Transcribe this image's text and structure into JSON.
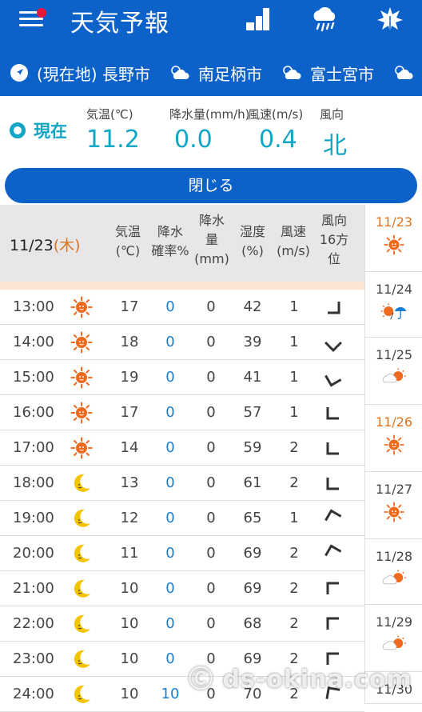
{
  "app": {
    "title": "天気予報"
  },
  "header_icons": [
    "ranking-icon",
    "rain-icon",
    "leaf-icon"
  ],
  "tabs": [
    {
      "label": "(現在地) 長野市",
      "icon": "location-arrow-icon"
    },
    {
      "label": "南足柄市",
      "icon": "cloud-sun-icon"
    },
    {
      "label": "富士宮市",
      "icon": "cloud-sun-icon"
    }
  ],
  "current": {
    "label": "現在",
    "metrics": [
      {
        "label": "気温(℃)",
        "value": "11.2"
      },
      {
        "label": "降水量(mm/h)",
        "value": "0.0"
      },
      {
        "label": "風速(m/s)",
        "value": "0.4"
      },
      {
        "label": "風向",
        "value": "北"
      }
    ]
  },
  "close_label": "閉じる",
  "table": {
    "date": "11/23",
    "weekday": "(木)",
    "headers": {
      "temp": [
        "気温",
        "(℃)"
      ],
      "prob": [
        "降水",
        "確率%"
      ],
      "rain": [
        "降水",
        "量",
        "(mm)"
      ],
      "humidity": [
        "湿度",
        "(%)"
      ],
      "windspeed": [
        "風速",
        "(m/s)"
      ],
      "winddir": [
        "風向",
        "16方",
        "位"
      ]
    },
    "rows": [
      {
        "time": "13:00",
        "weather": "sun",
        "temp": "17",
        "prob": "0",
        "rain": "0",
        "humidity": "42",
        "wind": "1",
        "dir_angle": 180
      },
      {
        "time": "14:00",
        "weather": "sun",
        "temp": "18",
        "prob": "0",
        "rain": "0",
        "humidity": "39",
        "wind": "1",
        "dir_angle": 225
      },
      {
        "time": "15:00",
        "weather": "sun",
        "temp": "19",
        "prob": "0",
        "rain": "0",
        "humidity": "41",
        "wind": "1",
        "dir_angle": 240
      },
      {
        "time": "16:00",
        "weather": "sun",
        "temp": "17",
        "prob": "0",
        "rain": "0",
        "humidity": "57",
        "wind": "1",
        "dir_angle": 270
      },
      {
        "time": "17:00",
        "weather": "sun",
        "temp": "14",
        "prob": "0",
        "rain": "0",
        "humidity": "59",
        "wind": "2",
        "dir_angle": 270
      },
      {
        "time": "18:00",
        "weather": "moon",
        "temp": "13",
        "prob": "0",
        "rain": "0",
        "humidity": "61",
        "wind": "2",
        "dir_angle": 270
      },
      {
        "time": "19:00",
        "weather": "moon",
        "temp": "12",
        "prob": "0",
        "rain": "0",
        "humidity": "65",
        "wind": "1",
        "dir_angle": 30
      },
      {
        "time": "20:00",
        "weather": "moon",
        "temp": "11",
        "prob": "0",
        "rain": "0",
        "humidity": "69",
        "wind": "2",
        "dir_angle": 30
      },
      {
        "time": "21:00",
        "weather": "moon",
        "temp": "10",
        "prob": "0",
        "rain": "0",
        "humidity": "69",
        "wind": "2",
        "dir_angle": 0
      },
      {
        "time": "22:00",
        "weather": "moon",
        "temp": "10",
        "prob": "0",
        "rain": "0",
        "humidity": "68",
        "wind": "2",
        "dir_angle": 0
      },
      {
        "time": "23:00",
        "weather": "moon",
        "temp": "10",
        "prob": "0",
        "rain": "0",
        "humidity": "69",
        "wind": "2",
        "dir_angle": 0
      },
      {
        "time": "24:00",
        "weather": "moon",
        "temp": "10",
        "prob": "10",
        "rain": "0",
        "humidity": "70",
        "wind": "2",
        "dir_angle": 10
      }
    ]
  },
  "days": [
    {
      "date": "11/23",
      "icon": "sun",
      "active": true
    },
    {
      "date": "11/24",
      "icon": "sun-umbrella",
      "active": false
    },
    {
      "date": "11/25",
      "icon": "cloud-sun",
      "active": false
    },
    {
      "date": "11/26",
      "icon": "sun",
      "active": true
    },
    {
      "date": "11/27",
      "icon": "sun",
      "active": false
    },
    {
      "date": "11/28",
      "icon": "cloud-sun",
      "active": false
    },
    {
      "date": "11/29",
      "icon": "cloud-sun",
      "active": false
    },
    {
      "date": "11/30",
      "icon": "sun",
      "active": false
    }
  ],
  "watermark": "ds-okina.com",
  "colors": {
    "primary": "#0d62c9",
    "accent": "#12a6c5",
    "sun": "#f06a1d",
    "moon": "#f5c400",
    "weekday": "#e0721b",
    "blue_value": "#1a7fd4"
  }
}
